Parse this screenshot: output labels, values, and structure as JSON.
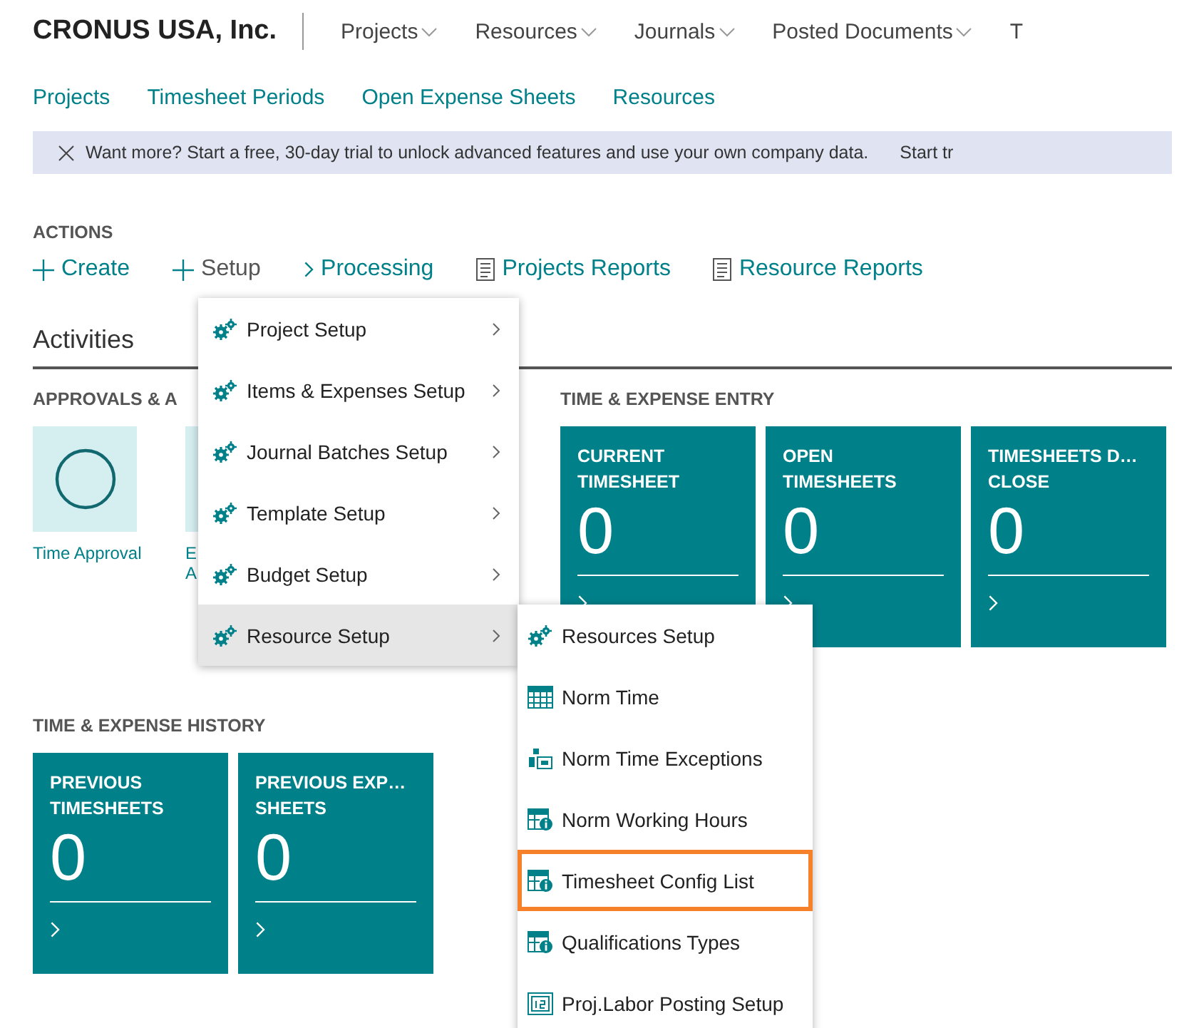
{
  "company": "CRONUS USA, Inc.",
  "top_nav": [
    {
      "label": "Projects",
      "has_caret": true
    },
    {
      "label": "Resources",
      "has_caret": true
    },
    {
      "label": "Journals",
      "has_caret": true
    },
    {
      "label": "Posted Documents",
      "has_caret": true
    },
    {
      "label": "T",
      "has_caret": false
    }
  ],
  "links": [
    "Projects",
    "Timesheet Periods",
    "Open Expense Sheets",
    "Resources"
  ],
  "banner": {
    "text": "Want more? Start a free, 30-day trial to unlock advanced features and use your own company data.",
    "action": "Start tr"
  },
  "actions": {
    "title": "ACTIONS",
    "items": [
      {
        "label": "Create",
        "kind": "plus"
      },
      {
        "label": "Setup",
        "kind": "plus"
      },
      {
        "label": "Processing",
        "kind": "chevron"
      },
      {
        "label": "Projects Reports",
        "kind": "report"
      },
      {
        "label": "Resource Reports",
        "kind": "report"
      }
    ]
  },
  "activities": {
    "title": "Activities",
    "approvals": {
      "title": "APPROVALS & A",
      "tiles": [
        {
          "label_lines": [
            "Time Approval"
          ]
        },
        {
          "label_lines": [
            "E",
            "A"
          ]
        }
      ]
    },
    "entry": {
      "title": "TIME & EXPENSE ENTRY",
      "tiles": [
        {
          "label_lines": [
            "CURRENT",
            "TIMESHEET"
          ],
          "value": "0"
        },
        {
          "label_lines": [
            "OPEN",
            "TIMESHEETS"
          ],
          "value": "0"
        },
        {
          "label_lines": [
            "TIMESHEETS D…",
            "CLOSE"
          ],
          "value": "0"
        }
      ]
    },
    "history": {
      "title": "TIME & EXPENSE HISTORY",
      "tiles": [
        {
          "label_lines": [
            "PREVIOUS",
            "TIMESHEETS"
          ],
          "value": "0"
        },
        {
          "label_lines": [
            "PREVIOUS EXP…",
            "SHEETS"
          ],
          "value": "0"
        }
      ]
    }
  },
  "setup_menu": [
    {
      "label": "Project Setup",
      "selected": false
    },
    {
      "label": "Items & Expenses Setup",
      "selected": false
    },
    {
      "label": "Journal Batches Setup",
      "selected": false
    },
    {
      "label": "Template Setup",
      "selected": false
    },
    {
      "label": "Budget Setup",
      "selected": false
    },
    {
      "label": "Resource Setup",
      "selected": true
    }
  ],
  "resource_menu": [
    {
      "label": "Resources Setup",
      "kind": "gears",
      "highlighted": false
    },
    {
      "label": "Norm Time",
      "kind": "grid",
      "highlighted": false
    },
    {
      "label": "Norm Time Exceptions",
      "kind": "exception",
      "highlighted": false
    },
    {
      "label": "Norm Working Hours",
      "kind": "info",
      "highlighted": false
    },
    {
      "label": "Timesheet Config List",
      "kind": "info",
      "highlighted": true
    },
    {
      "label": "Qualifications Types",
      "kind": "info",
      "highlighted": false
    },
    {
      "label": "Proj.Labor Posting Setup",
      "kind": "calendar",
      "highlighted": false
    }
  ]
}
